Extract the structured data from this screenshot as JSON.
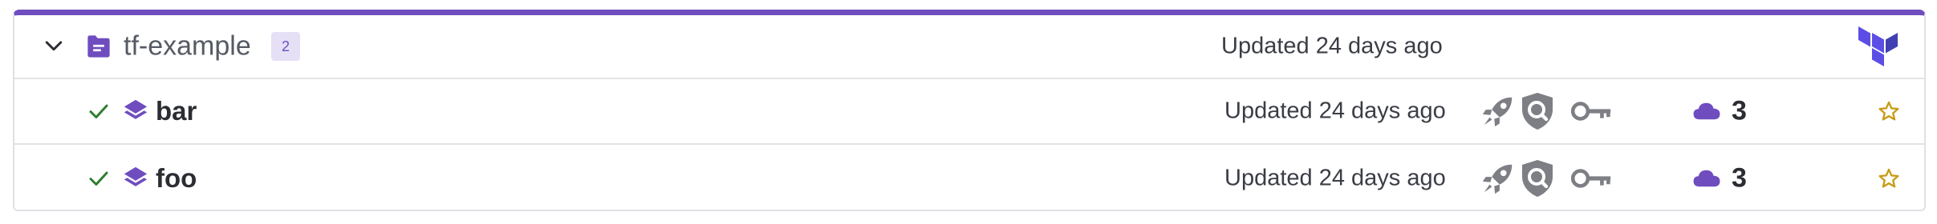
{
  "colors": {
    "accent": "#6f4dbf",
    "check": "#2f7d2f",
    "star": "#c89b17",
    "icon_gray": "#7d7f85"
  },
  "group": {
    "name": "tf-example",
    "count": "2",
    "updated": "Updated 24 days ago",
    "icons": [
      "chevron-down-icon",
      "folder-icon",
      "terraform-logo"
    ]
  },
  "workspaces": [
    {
      "name": "bar",
      "updated": "Updated 24 days ago",
      "resources": "3",
      "icons": [
        "check-icon",
        "layers-icon",
        "rocket-icon",
        "shield-search-icon",
        "key-icon",
        "cloud-icon",
        "star-icon"
      ]
    },
    {
      "name": "foo",
      "updated": "Updated 24 days ago",
      "resources": "3",
      "icons": [
        "check-icon",
        "layers-icon",
        "rocket-icon",
        "shield-search-icon",
        "key-icon",
        "cloud-icon",
        "star-icon"
      ]
    }
  ]
}
